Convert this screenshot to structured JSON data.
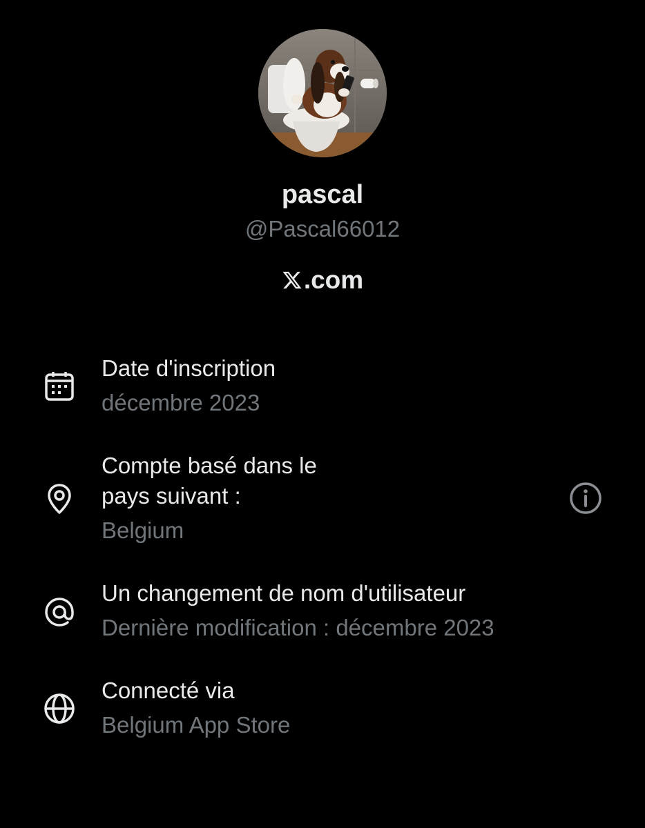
{
  "profile": {
    "display_name": "pascal",
    "handle": "@Pascal66012",
    "site_suffix": ".com"
  },
  "details": [
    {
      "icon": "calendar-icon",
      "title": "Date d'inscription",
      "value": "décembre 2023"
    },
    {
      "icon": "location-pin-icon",
      "title": "Compte basé dans le\npays suivant :",
      "value": "Belgium"
    },
    {
      "icon": "at-sign-icon",
      "title": "Un changement de nom d'utilisateur",
      "value": "Dernière modification : décembre 2023"
    },
    {
      "icon": "globe-icon",
      "title": "Connecté via",
      "value": "Belgium App Store"
    }
  ],
  "colors": {
    "background": "#000000",
    "primary_text": "#e7e9ea",
    "secondary_text": "#71767b"
  }
}
